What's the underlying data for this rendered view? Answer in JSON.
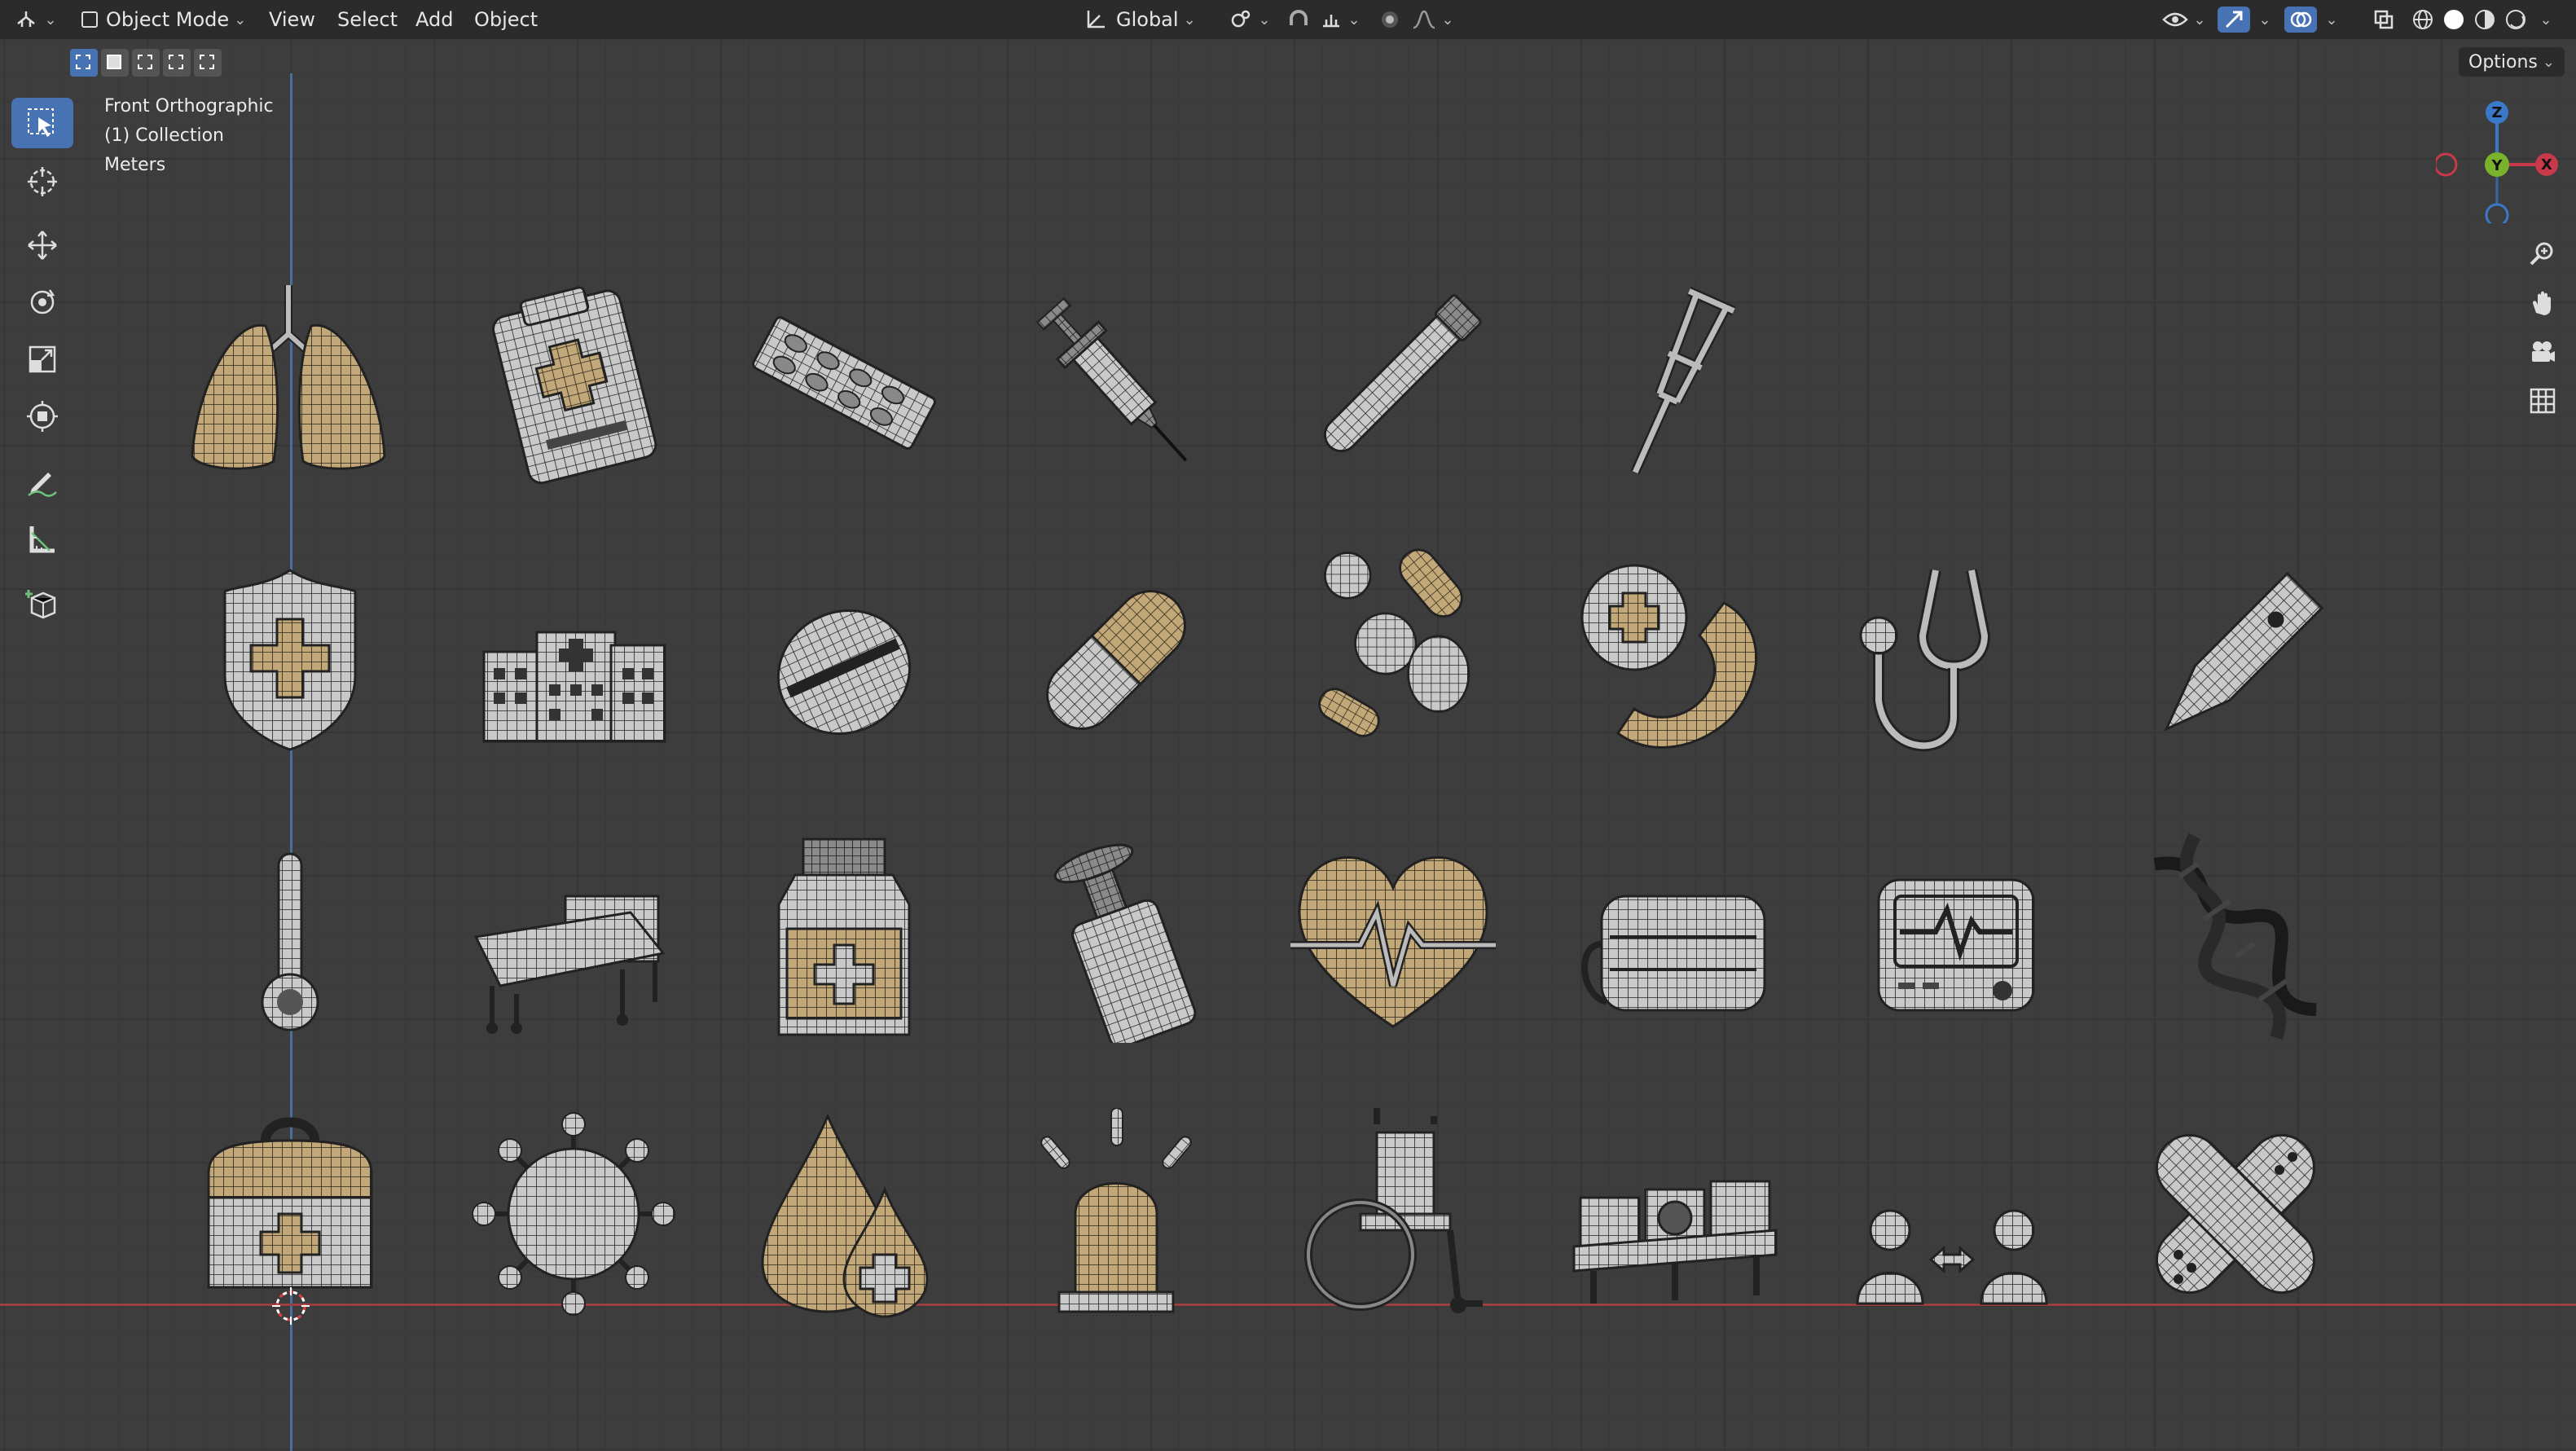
{
  "header": {
    "mode": "Object Mode",
    "menus": [
      "View",
      "Select",
      "Add",
      "Object"
    ],
    "orientation": "Global",
    "options": "Options"
  },
  "viewport_info": {
    "view": "Front Orthographic",
    "collection": "(1) Collection",
    "units": "Meters"
  },
  "gizmo": {
    "z": "Z",
    "y": "Y",
    "x": "X"
  },
  "colors": {
    "viewport_bg": "#3d3d3d",
    "header_bg": "#2b2b2b",
    "active_blue": "#4772b3",
    "axis_x": "#c8394a",
    "axis_y": "#7ab22c",
    "axis_z": "#3a78c8",
    "wire_gray": "#b8b8b8",
    "wire_tan": "#c2a878"
  },
  "toolbar_tools": [
    "select-box",
    "cursor",
    "move",
    "rotate",
    "scale",
    "transform",
    "annotate",
    "measure",
    "add-cube"
  ],
  "objects": [
    "lungs",
    "clipboard",
    "pill-blister",
    "syringe",
    "test-tube",
    "crutch",
    "shield-cross",
    "hospital-building",
    "round-pill",
    "capsule",
    "pills-pile",
    "phone-cross",
    "stethoscope",
    "thermometer-digital",
    "thermometer",
    "hospital-bed",
    "medicine-jar",
    "pill-bottle",
    "heart-pulse",
    "face-mask",
    "ecg-monitor",
    "dna",
    "first-aid-kit",
    "virus",
    "blood-drop",
    "alarm-light",
    "wheelchair",
    "waiting-chairs",
    "social-distance",
    "bandage"
  ]
}
